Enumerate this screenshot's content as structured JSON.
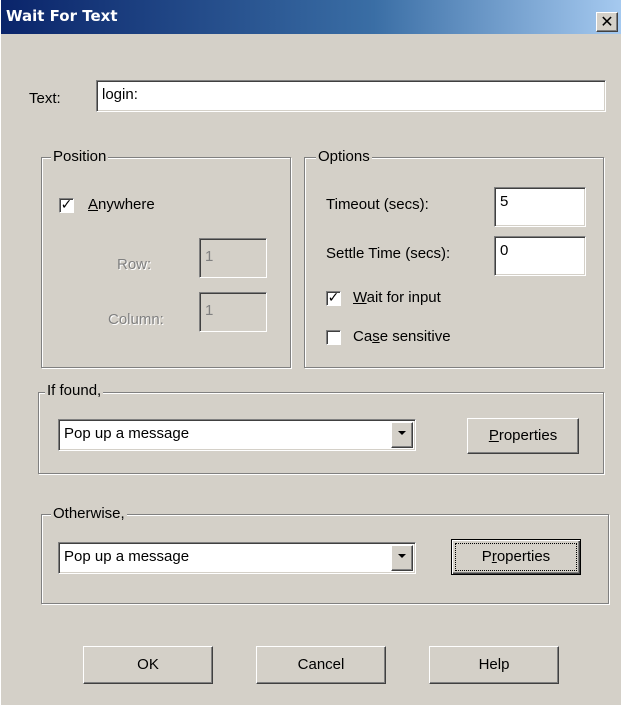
{
  "window": {
    "title": "Wait For Text",
    "close_glyph": "✕"
  },
  "text_field": {
    "label": "Text:",
    "value": "login:"
  },
  "position": {
    "legend": "Position",
    "anywhere": {
      "pre": "",
      "key": "A",
      "post": "nywhere",
      "checked": true
    },
    "row": {
      "label": "Row:",
      "value": "1"
    },
    "column": {
      "label": "Column:",
      "value": "1"
    }
  },
  "options": {
    "legend": "Options",
    "timeout": {
      "label": "Timeout (secs):",
      "value": "5"
    },
    "settle_time": {
      "label": "Settle Time (secs):",
      "value": "0"
    },
    "wait_for_input": {
      "pre": "",
      "key": "W",
      "post": "ait for input",
      "checked": true
    },
    "case_sensitive": {
      "pre": "Ca",
      "key": "s",
      "post": "e sensitive",
      "checked": false
    }
  },
  "if_found": {
    "legend": "If found,",
    "selected": "Pop up a message",
    "properties": {
      "pre": "",
      "key": "P",
      "post": "roperties"
    }
  },
  "otherwise": {
    "legend": "Otherwise,",
    "selected": "Pop up a message",
    "properties": {
      "pre": "P",
      "key": "r",
      "post": "operties"
    }
  },
  "buttons": {
    "ok": "OK",
    "cancel": "Cancel",
    "help": "Help"
  }
}
